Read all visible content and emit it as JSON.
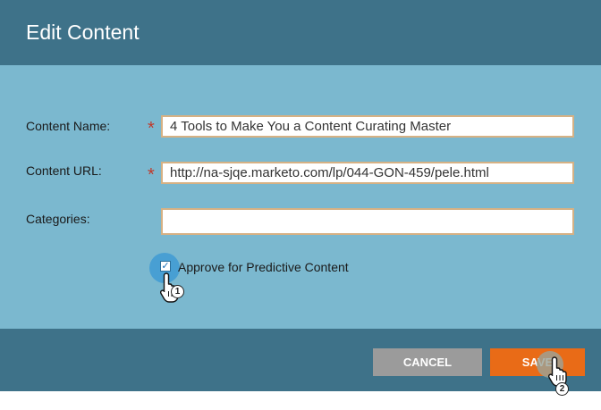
{
  "dialog": {
    "title": "Edit Content",
    "fields": [
      {
        "label": "Content Name:",
        "required": true,
        "value": "4 Tools to Make You a Content Curating Master"
      },
      {
        "label": "Content URL:",
        "required": true,
        "value": "http://na-sjqe.marketo.com/lp/044-GON-459/pele.html"
      },
      {
        "label": "Categories:",
        "required": false,
        "value": ""
      }
    ],
    "required_marker": "*",
    "approve_checkbox": {
      "label": "Approve for Predictive Content",
      "checked": true,
      "check_glyph": "✓"
    },
    "buttons": {
      "cancel": "CANCEL",
      "save": "SAVE"
    }
  },
  "annotations": {
    "step1": "1",
    "step2": "2"
  },
  "colors": {
    "header": "#3e7289",
    "body": "#7bb8cf",
    "save_button": "#e96b17",
    "cancel_button": "#9b9b9b",
    "required_marker": "#c0392b"
  }
}
